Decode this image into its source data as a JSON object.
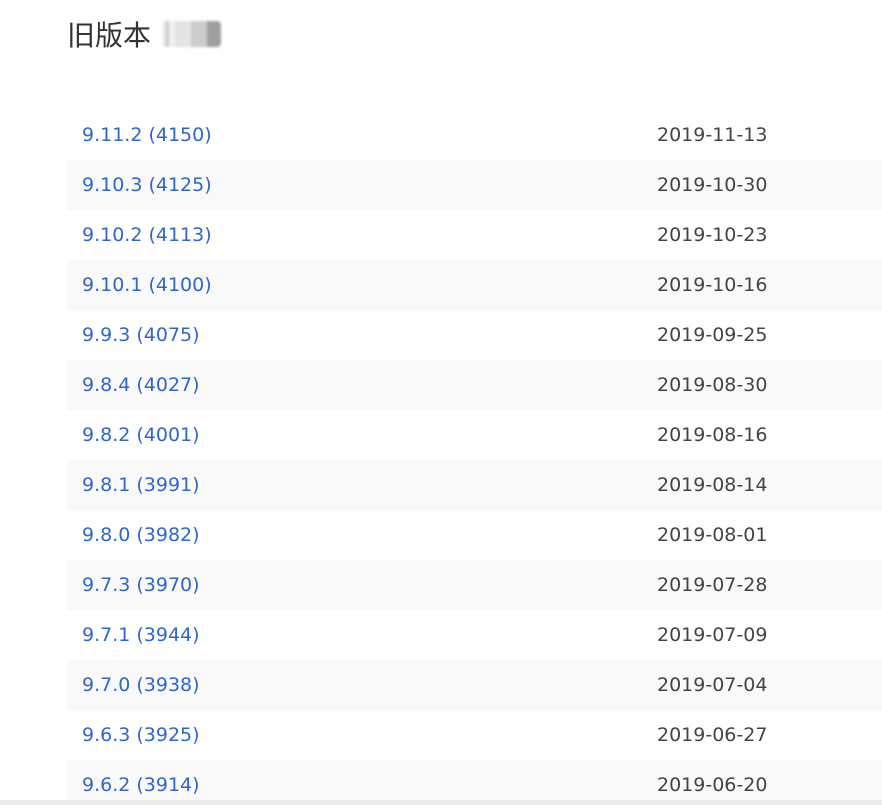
{
  "heading": {
    "title": "旧版本"
  },
  "versions": [
    {
      "label": "9.11.2 (4150)",
      "date": "2019-11-13"
    },
    {
      "label": "9.10.3 (4125)",
      "date": "2019-10-30"
    },
    {
      "label": "9.10.2 (4113)",
      "date": "2019-10-23"
    },
    {
      "label": "9.10.1 (4100)",
      "date": "2019-10-16"
    },
    {
      "label": "9.9.3 (4075)",
      "date": "2019-09-25"
    },
    {
      "label": "9.8.4 (4027)",
      "date": "2019-08-30"
    },
    {
      "label": "9.8.2 (4001)",
      "date": "2019-08-16"
    },
    {
      "label": "9.8.1 (3991)",
      "date": "2019-08-14"
    },
    {
      "label": "9.8.0 (3982)",
      "date": "2019-08-01"
    },
    {
      "label": "9.7.3 (3970)",
      "date": "2019-07-28"
    },
    {
      "label": "9.7.1 (3944)",
      "date": "2019-07-09"
    },
    {
      "label": "9.7.0 (3938)",
      "date": "2019-07-04"
    },
    {
      "label": "9.6.3 (3925)",
      "date": "2019-06-27"
    },
    {
      "label": "9.6.2 (3914)",
      "date": "2019-06-20"
    }
  ],
  "colors": {
    "link": "#2f67c9",
    "date_text": "#444444",
    "heading_text": "#333333",
    "stripe": "#f9f9f9"
  }
}
